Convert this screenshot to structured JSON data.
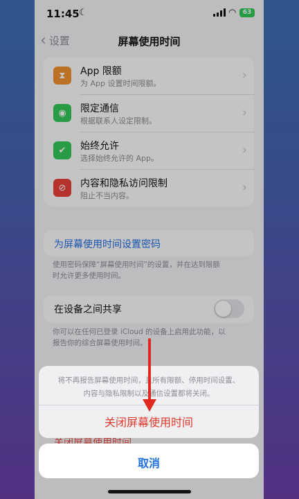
{
  "status": {
    "time": "11:45",
    "battery": "63"
  },
  "nav": {
    "back_label": "设置",
    "title": "屏幕使用时间"
  },
  "rows": [
    {
      "title": "App 限额",
      "subtitle": "为 App 设置时间限额。",
      "icon": "hourglass-icon",
      "color": "#f0922f"
    },
    {
      "title": "限定通信",
      "subtitle": "根据联系人设定限制。",
      "icon": "person-icon",
      "color": "#34c759"
    },
    {
      "title": "始终允许",
      "subtitle": "选择始终允许的 App。",
      "icon": "checkmark-badge-icon",
      "color": "#34c759"
    },
    {
      "title": "内容和隐私访问限制",
      "subtitle": "阻止不当内容。",
      "icon": "no-entry-icon",
      "color": "#e8403a"
    }
  ],
  "passcode": {
    "link": "为屏幕使用时间设置密码",
    "note_line1": "使用密码保障“屏幕使用时间”的设置，并在达到限额",
    "note_line2": "时允许更多使用时间。"
  },
  "share": {
    "label": "在设备之间共享",
    "toggle_on": false,
    "note_line1": "你可以在任何已登录 iCloud 的设备上启用此功能，以",
    "note_line2": "报告你的综合屏幕使用时间。"
  },
  "background_action": "关闭屏幕使用时间",
  "action_sheet": {
    "message_line1": "将不再报告屏幕使用时间，且所有限额、停用时间设置、",
    "message_line2": "内容与隐私限制以及通信设置都将关闭。",
    "destructive_action": "关闭屏幕使用时间",
    "cancel": "取消"
  },
  "colors": {
    "link": "#1f6fe0",
    "destructive": "#e1382c",
    "annotation_arrow": "#e0281f"
  }
}
